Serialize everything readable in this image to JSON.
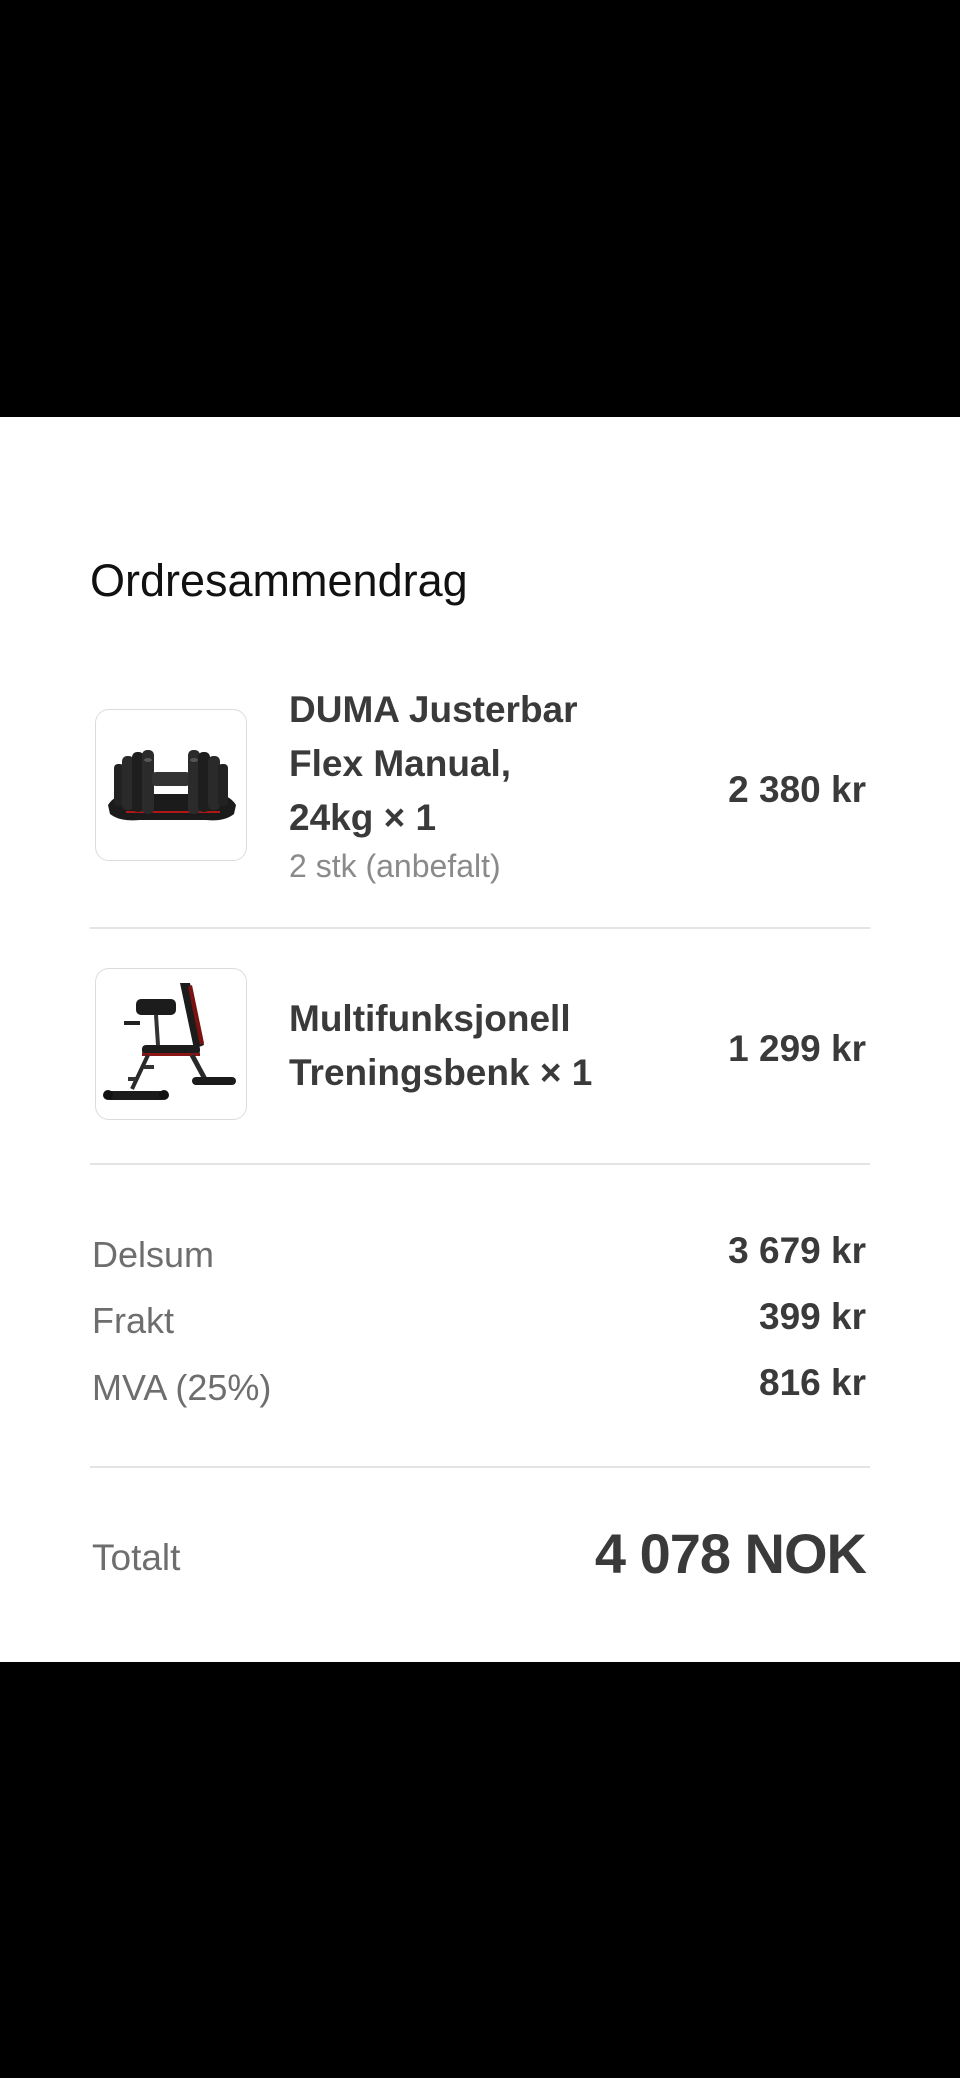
{
  "order_summary": {
    "title": "Ordresammendrag",
    "items": [
      {
        "name_lines": [
          "DUMA Justerbar",
          "Flex Manual,",
          "24kg × 1"
        ],
        "note": "2 stk (anbefalt)",
        "price": "2 380 kr",
        "image_icon": "adjustable-dumbbell-image"
      },
      {
        "name_lines": [
          "Multifunksjonell",
          "Treningsbenk × 1"
        ],
        "price": "1 299 kr",
        "image_icon": "training-bench-image"
      }
    ],
    "subtotal": {
      "label": "Delsum",
      "value": "3 679 kr"
    },
    "shipping": {
      "label": "Frakt",
      "value": "399 kr"
    },
    "vat": {
      "label": "MVA (25%)",
      "value": "816 kr"
    },
    "total": {
      "label": "Totalt",
      "value": "4 078 NOK"
    }
  },
  "colors": {
    "background": "#000000",
    "panel": "#ffffff",
    "text_primary": "#3a3a3a",
    "text_muted": "#6e6e6e",
    "divider": "#e4e4e4"
  }
}
